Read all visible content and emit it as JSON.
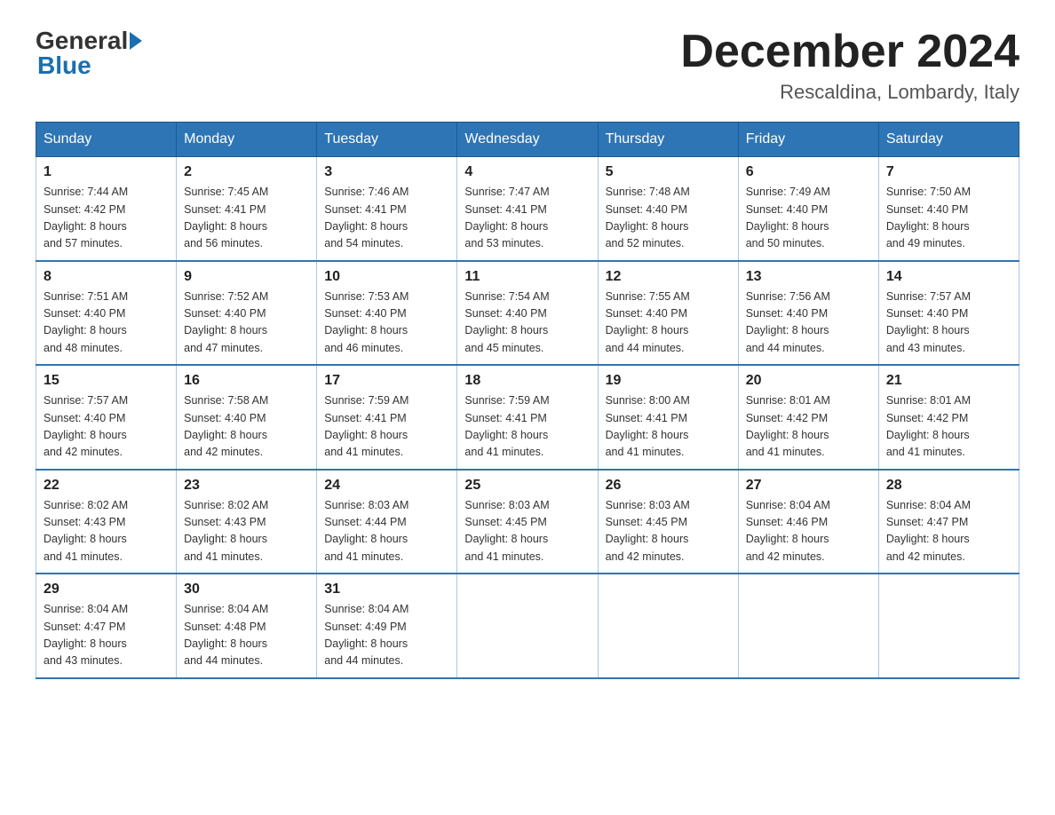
{
  "logo": {
    "general": "General",
    "blue": "Blue"
  },
  "title": "December 2024",
  "location": "Rescaldina, Lombardy, Italy",
  "days_of_week": [
    "Sunday",
    "Monday",
    "Tuesday",
    "Wednesday",
    "Thursday",
    "Friday",
    "Saturday"
  ],
  "weeks": [
    [
      {
        "day": "1",
        "sunrise": "7:44 AM",
        "sunset": "4:42 PM",
        "daylight": "8 hours and 57 minutes."
      },
      {
        "day": "2",
        "sunrise": "7:45 AM",
        "sunset": "4:41 PM",
        "daylight": "8 hours and 56 minutes."
      },
      {
        "day": "3",
        "sunrise": "7:46 AM",
        "sunset": "4:41 PM",
        "daylight": "8 hours and 54 minutes."
      },
      {
        "day": "4",
        "sunrise": "7:47 AM",
        "sunset": "4:41 PM",
        "daylight": "8 hours and 53 minutes."
      },
      {
        "day": "5",
        "sunrise": "7:48 AM",
        "sunset": "4:40 PM",
        "daylight": "8 hours and 52 minutes."
      },
      {
        "day": "6",
        "sunrise": "7:49 AM",
        "sunset": "4:40 PM",
        "daylight": "8 hours and 50 minutes."
      },
      {
        "day": "7",
        "sunrise": "7:50 AM",
        "sunset": "4:40 PM",
        "daylight": "8 hours and 49 minutes."
      }
    ],
    [
      {
        "day": "8",
        "sunrise": "7:51 AM",
        "sunset": "4:40 PM",
        "daylight": "8 hours and 48 minutes."
      },
      {
        "day": "9",
        "sunrise": "7:52 AM",
        "sunset": "4:40 PM",
        "daylight": "8 hours and 47 minutes."
      },
      {
        "day": "10",
        "sunrise": "7:53 AM",
        "sunset": "4:40 PM",
        "daylight": "8 hours and 46 minutes."
      },
      {
        "day": "11",
        "sunrise": "7:54 AM",
        "sunset": "4:40 PM",
        "daylight": "8 hours and 45 minutes."
      },
      {
        "day": "12",
        "sunrise": "7:55 AM",
        "sunset": "4:40 PM",
        "daylight": "8 hours and 44 minutes."
      },
      {
        "day": "13",
        "sunrise": "7:56 AM",
        "sunset": "4:40 PM",
        "daylight": "8 hours and 44 minutes."
      },
      {
        "day": "14",
        "sunrise": "7:57 AM",
        "sunset": "4:40 PM",
        "daylight": "8 hours and 43 minutes."
      }
    ],
    [
      {
        "day": "15",
        "sunrise": "7:57 AM",
        "sunset": "4:40 PM",
        "daylight": "8 hours and 42 minutes."
      },
      {
        "day": "16",
        "sunrise": "7:58 AM",
        "sunset": "4:40 PM",
        "daylight": "8 hours and 42 minutes."
      },
      {
        "day": "17",
        "sunrise": "7:59 AM",
        "sunset": "4:41 PM",
        "daylight": "8 hours and 41 minutes."
      },
      {
        "day": "18",
        "sunrise": "7:59 AM",
        "sunset": "4:41 PM",
        "daylight": "8 hours and 41 minutes."
      },
      {
        "day": "19",
        "sunrise": "8:00 AM",
        "sunset": "4:41 PM",
        "daylight": "8 hours and 41 minutes."
      },
      {
        "day": "20",
        "sunrise": "8:01 AM",
        "sunset": "4:42 PM",
        "daylight": "8 hours and 41 minutes."
      },
      {
        "day": "21",
        "sunrise": "8:01 AM",
        "sunset": "4:42 PM",
        "daylight": "8 hours and 41 minutes."
      }
    ],
    [
      {
        "day": "22",
        "sunrise": "8:02 AM",
        "sunset": "4:43 PM",
        "daylight": "8 hours and 41 minutes."
      },
      {
        "day": "23",
        "sunrise": "8:02 AM",
        "sunset": "4:43 PM",
        "daylight": "8 hours and 41 minutes."
      },
      {
        "day": "24",
        "sunrise": "8:03 AM",
        "sunset": "4:44 PM",
        "daylight": "8 hours and 41 minutes."
      },
      {
        "day": "25",
        "sunrise": "8:03 AM",
        "sunset": "4:45 PM",
        "daylight": "8 hours and 41 minutes."
      },
      {
        "day": "26",
        "sunrise": "8:03 AM",
        "sunset": "4:45 PM",
        "daylight": "8 hours and 42 minutes."
      },
      {
        "day": "27",
        "sunrise": "8:04 AM",
        "sunset": "4:46 PM",
        "daylight": "8 hours and 42 minutes."
      },
      {
        "day": "28",
        "sunrise": "8:04 AM",
        "sunset": "4:47 PM",
        "daylight": "8 hours and 42 minutes."
      }
    ],
    [
      {
        "day": "29",
        "sunrise": "8:04 AM",
        "sunset": "4:47 PM",
        "daylight": "8 hours and 43 minutes."
      },
      {
        "day": "30",
        "sunrise": "8:04 AM",
        "sunset": "4:48 PM",
        "daylight": "8 hours and 44 minutes."
      },
      {
        "day": "31",
        "sunrise": "8:04 AM",
        "sunset": "4:49 PM",
        "daylight": "8 hours and 44 minutes."
      },
      null,
      null,
      null,
      null
    ]
  ],
  "labels": {
    "sunrise": "Sunrise:",
    "sunset": "Sunset:",
    "daylight": "Daylight:"
  }
}
